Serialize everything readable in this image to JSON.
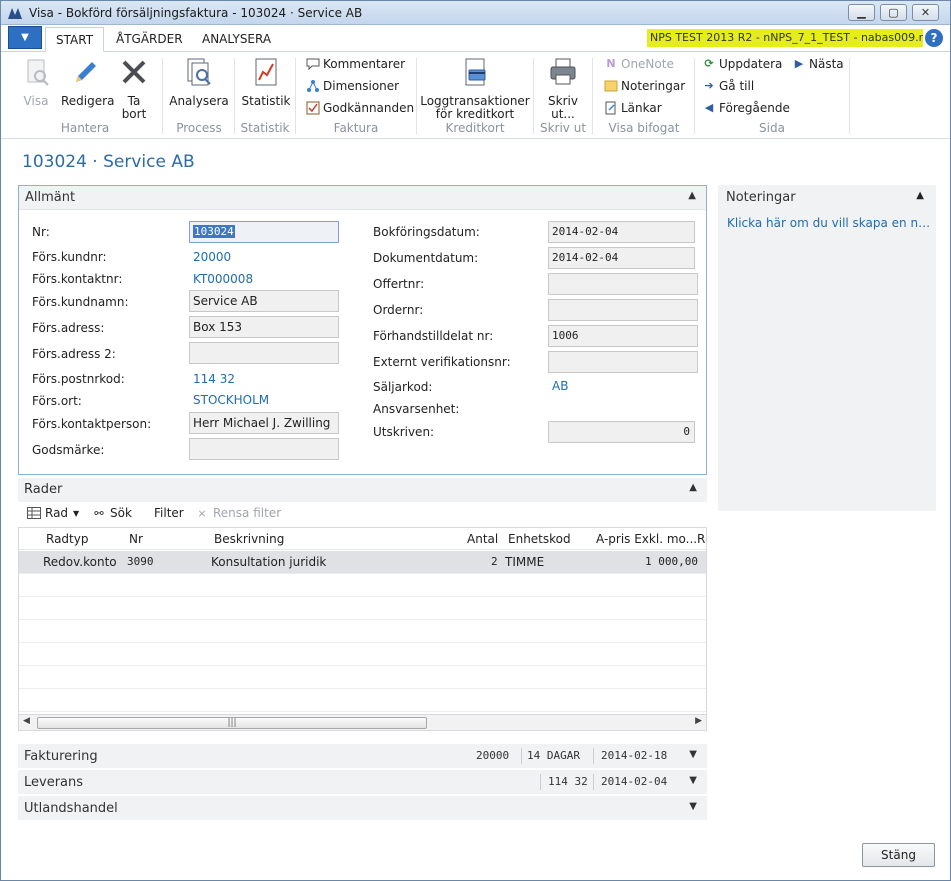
{
  "window": {
    "title": "Visa - Bokförd försäljningsfaktura - 103024 · Service AB"
  },
  "tabs": [
    "START",
    "ÅTGÄRDER",
    "ANALYSERA"
  ],
  "company": "NPS TEST 2013 R2 - nNPS_7_1_TEST - nabas009.n...",
  "help": "?",
  "ribbon": {
    "hantera": {
      "label": "Hantera",
      "visa": "Visa",
      "redigera": "Redigera",
      "ta_bort_1": "Ta",
      "ta_bort_2": "bort"
    },
    "process": {
      "label": "Process",
      "analysera": "Analysera"
    },
    "statistik": {
      "label": "Statistik",
      "statistik": "Statistik"
    },
    "faktura": {
      "label": "Faktura",
      "kommentarer": "Kommentarer",
      "dimensioner": "Dimensioner",
      "godkannanden": "Godkännanden"
    },
    "kreditkort": {
      "label": "Kreditkort",
      "logg_1": "Loggtransaktioner",
      "logg_2": "för kreditkort"
    },
    "skriv_ut": {
      "label": "Skriv ut",
      "skriv_1": "Skriv",
      "skriv_2": "ut..."
    },
    "visa_bifogat": {
      "label": "Visa bifogat",
      "onenote": "OneNote",
      "noteringar": "Noteringar",
      "lankar": "Länkar"
    },
    "sida": {
      "label": "Sida",
      "uppdatera": "Uppdatera",
      "nasta": "Nästa",
      "ga_till": "Gå till",
      "foregaende": "Föregående"
    }
  },
  "page_title": "103024 · Service AB",
  "allmant": {
    "title": "Allmänt",
    "left": [
      {
        "label": "Nr:",
        "value": "103024"
      },
      {
        "label": "Förs.kundnr:",
        "value": "20000"
      },
      {
        "label": "Förs.kontaktnr:",
        "value": "KT000008"
      },
      {
        "label": "Förs.kundnamn:",
        "value": "Service AB"
      },
      {
        "label": "Förs.adress:",
        "value": "Box 153"
      },
      {
        "label": "Förs.adress 2:",
        "value": ""
      },
      {
        "label": "Förs.postnrkod:",
        "value": "114 32"
      },
      {
        "label": "Förs.ort:",
        "value": "STOCKHOLM"
      },
      {
        "label": "Förs.kontaktperson:",
        "value": "Herr Michael J. Zwilling"
      },
      {
        "label": "Godsmärke:",
        "value": ""
      }
    ],
    "right": [
      {
        "label": "Bokföringsdatum:",
        "value": "2014-02-04"
      },
      {
        "label": "Dokumentdatum:",
        "value": "2014-02-04"
      },
      {
        "label": "Offertnr:",
        "value": ""
      },
      {
        "label": "Ordernr:",
        "value": ""
      },
      {
        "label": "Förhandstilldelat nr:",
        "value": "1006"
      },
      {
        "label": "Externt verifikationsnr:",
        "value": ""
      },
      {
        "label": "Säljarkod:",
        "value": "AB"
      },
      {
        "label": "Ansvarsenhet:",
        "value": ""
      },
      {
        "label": "Utskriven:",
        "value": "0"
      }
    ]
  },
  "noteringar": {
    "title": "Noteringar",
    "link": "Klicka här om du vill skapa en ny an..."
  },
  "rader": {
    "title": "Rader",
    "toolbar": {
      "rad": "Rad",
      "sok": "Sök",
      "filter": "Filter",
      "rensa": "Rensa filter"
    },
    "columns": [
      "Radtyp",
      "Nr",
      "Beskrivning",
      "Antal",
      "Enhetskod",
      "A-pris Exkl. mo...",
      "Ra"
    ],
    "rows": [
      {
        "radtyp": "Redov.konto",
        "nr": "3090",
        "beskrivning": "Konsultation juridik",
        "antal": "2",
        "enhetskod": "TIMME",
        "apris": "1 000,00"
      }
    ]
  },
  "fakturering": {
    "title": "Fakturering",
    "s1": "20000",
    "s2": "14 DAGAR",
    "s3": "2014-02-18"
  },
  "leverans": {
    "title": "Leverans",
    "s1": "114 32",
    "s2": "2014-02-04"
  },
  "utlandshandel": {
    "title": "Utlandshandel"
  },
  "buttons": {
    "stang": "Stäng"
  }
}
